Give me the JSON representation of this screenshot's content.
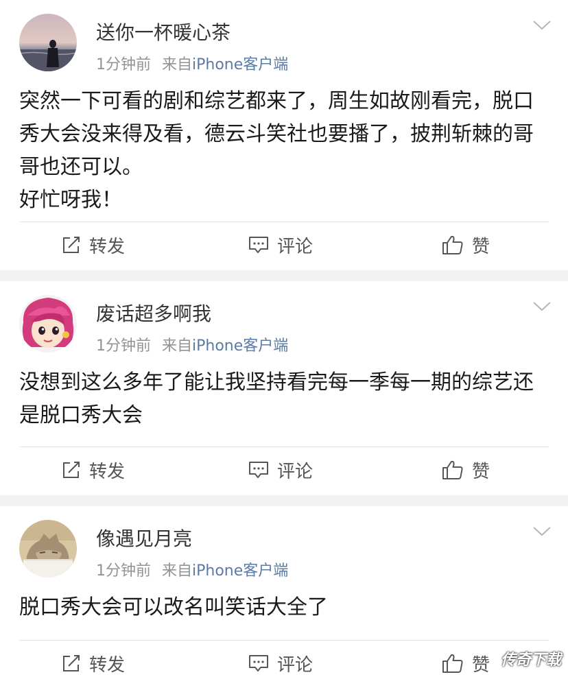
{
  "posts": [
    {
      "username": "送你一杯暖心茶",
      "time": "1分钟前",
      "source_prefix": "来自",
      "client": "iPhone客户端",
      "content": [
        "突然一下可看的剧和综艺都来了，周生如故刚看完，脱口秀大会没来得及看，德云斗笑社也要播了，披荆斩棘的哥哥也还可以。",
        "好忙呀我！"
      ],
      "repost_label": "转发",
      "comment_label": "评论",
      "like_label": "赞"
    },
    {
      "username": "废话超多啊我",
      "time": "1分钟前",
      "source_prefix": "来自",
      "client": "iPhone客户端",
      "content": [
        "没想到这么多年了能让我坚持看完每一季每一期的综艺还是脱口秀大会"
      ],
      "repost_label": "转发",
      "comment_label": "评论",
      "like_label": "赞"
    },
    {
      "username": "像遇见月亮",
      "time": "1分钟前",
      "source_prefix": "来自",
      "client": "iPhone客户端",
      "content": [
        "脱口秀大会可以改名叫笑话大全了"
      ],
      "repost_label": "转发",
      "comment_label": "评论",
      "like_label": "赞"
    }
  ],
  "watermark": "传奇下载",
  "colors": {
    "username": "#333333",
    "meta": "#939393",
    "client_link": "#5b7ba3",
    "separator": "#f2f2f2"
  }
}
